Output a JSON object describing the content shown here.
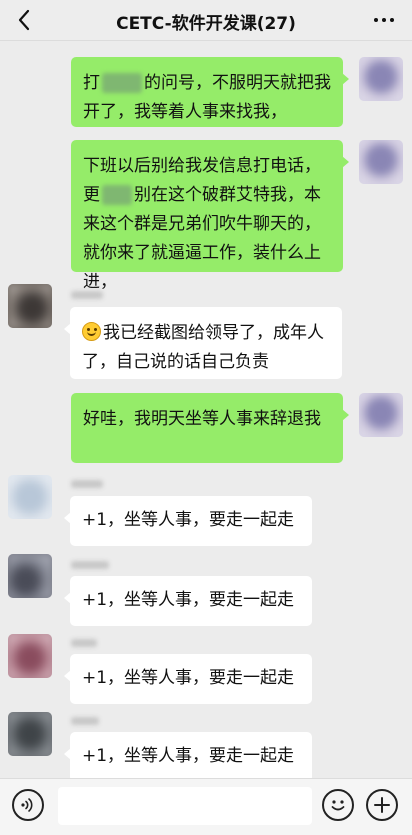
{
  "header": {
    "title": "CETC-软件开发课(27)",
    "back_icon": "back-chevron-icon",
    "more_icon": "more-dots-icon"
  },
  "messages": [
    {
      "side": "right",
      "parts": [
        "打",
        "的问号，不服明天就把我开了，我等着人事来找我，"
      ]
    },
    {
      "side": "right",
      "parts": [
        "下班以后别给我发信息打电话，更",
        "别在这个破群艾特我，本来这个群是兄弟们吹牛聊天的，就你来了就逼逼工作，装什么上进，"
      ]
    },
    {
      "side": "left",
      "text": "我已经截图给领导了，成年人了，自己说的话自己负责",
      "emoji": "smile-emoji"
    },
    {
      "side": "right",
      "text": "好哇，我明天坐等人事来辞退我"
    },
    {
      "side": "left",
      "text": "+1，坐等人事，要走一起走"
    },
    {
      "side": "left",
      "text": "+1，坐等人事，要走一起走"
    },
    {
      "side": "left",
      "text": "+1，坐等人事，要走一起走"
    },
    {
      "side": "left",
      "text": "+1，坐等人事，要走一起走"
    }
  ],
  "bottom": {
    "voice_icon": "voice-icon",
    "input_value": "",
    "emoji_icon": "emoji-icon",
    "plus_icon": "plus-icon"
  },
  "colors": {
    "green_bubble": "#95ec69",
    "white_bubble": "#ffffff",
    "background": "#ececec"
  }
}
